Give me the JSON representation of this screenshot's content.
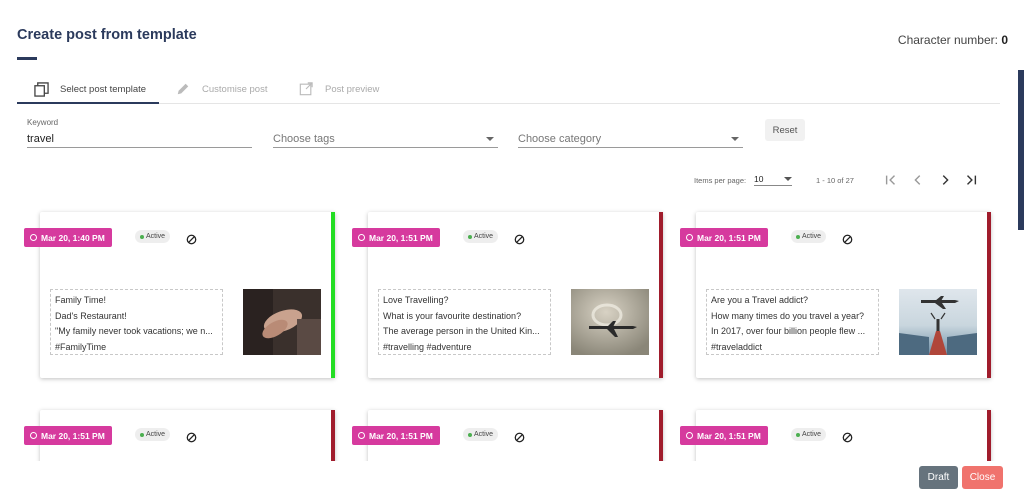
{
  "dialog": {
    "title": "Create post from template",
    "char_label": "Character number:",
    "char_value": "0"
  },
  "steps": [
    {
      "label": "Select post template",
      "icon": "copy-icon",
      "active": true
    },
    {
      "label": "Customise post",
      "icon": "pencil-icon",
      "active": false
    },
    {
      "label": "Post preview",
      "icon": "external-link-icon",
      "active": false
    }
  ],
  "filters": {
    "keyword_label": "Keyword",
    "keyword_value": "travel",
    "tags_placeholder": "Choose tags",
    "category_placeholder": "Choose category",
    "reset_label": "Reset"
  },
  "pager": {
    "items_label": "Items per page:",
    "items_value": "10",
    "range": "1 - 10 of 27"
  },
  "cards": [
    {
      "date": "Mar 20, 1:40 PM",
      "status": "Active",
      "accent": "#22dd22",
      "lines": [
        "Family Time!",
        "Dad's Restaurant!",
        "\"My family never took vacations; we n...",
        "#FamilyTime"
      ],
      "image": "hands-photo"
    },
    {
      "date": "Mar 20, 1:51 PM",
      "status": "Active",
      "accent": "#a01c2c",
      "lines": [
        "Love Travelling?",
        "What is your favourite destination?",
        "The average person in the United Kin...",
        "#travelling #adventure"
      ],
      "image": "airplane-clouds-photo"
    },
    {
      "date": "Mar 20, 1:51 PM",
      "status": "Active",
      "accent": "#a01c2c",
      "lines": [
        "Are you a Travel addict?",
        "How many times do you travel a year?",
        "In 2017, over four billion people flew ...",
        "#traveladdict"
      ],
      "image": "pier-airplane-photo"
    },
    {
      "date": "Mar 20, 1:51 PM",
      "status": "Active",
      "accent": "#a01c2c"
    },
    {
      "date": "Mar 20, 1:51 PM",
      "status": "Active",
      "accent": "#a01c2c"
    },
    {
      "date": "Mar 20, 1:51 PM",
      "status": "Active",
      "accent": "#a01c2c"
    }
  ],
  "footer": {
    "draft_label": "Draft",
    "close_label": "Close"
  },
  "colors": {
    "primary": "#2b3a5c",
    "date_badge": "#d63a9e",
    "active_accent": "#22dd22",
    "inactive_accent": "#a01c2c",
    "draft_button": "#66737d",
    "close_button": "#f0736d"
  }
}
